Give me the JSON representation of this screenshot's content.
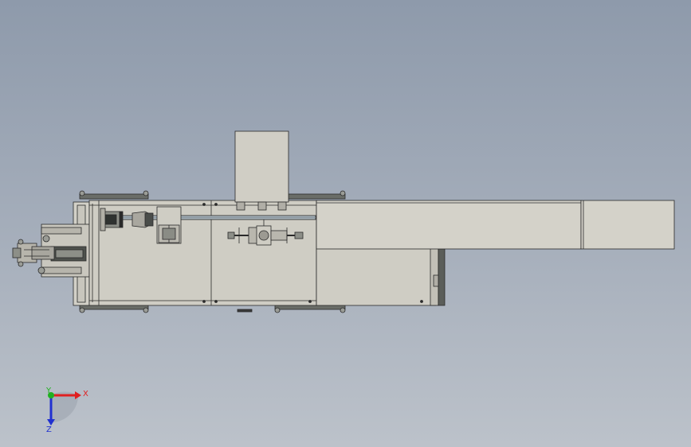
{
  "triad": {
    "x_label": "X",
    "y_label": "Y",
    "z_label": "Z",
    "x_color": "#e02020",
    "y_color": "#20b020",
    "z_color": "#2030d0"
  },
  "colors": {
    "background_top": "#8e9aab",
    "background_bottom": "#bcc2ca",
    "panel": "#cfcdc4",
    "panel_light": "#d6d4cb",
    "edge": "#2a2a2a",
    "dark_rail": "#5b5e5a"
  }
}
